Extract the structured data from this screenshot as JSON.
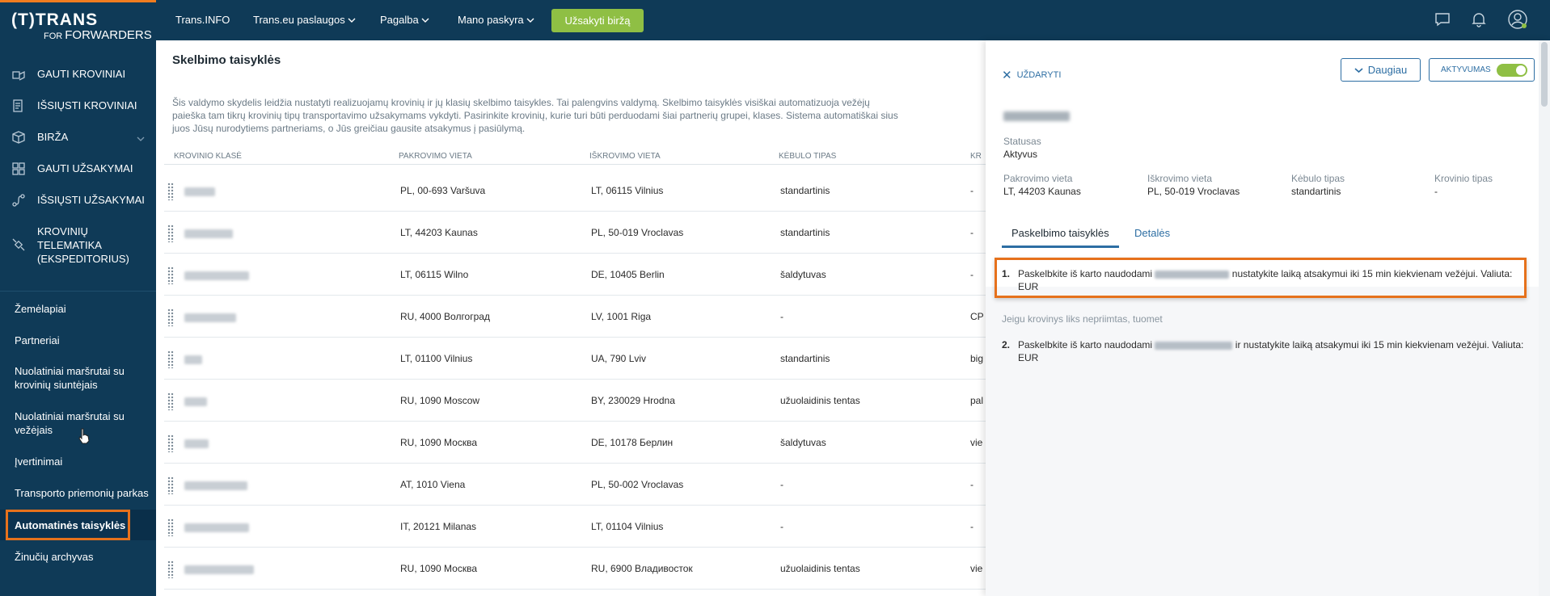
{
  "brand": {
    "logo_top": "(T)TRANS",
    "logo_bottom_small": "FOR",
    "logo_bottom": "FORWARDERS",
    "accent": "#f07c1f",
    "nav_bg": "#0f3a57",
    "cta_color": "#8fbf44"
  },
  "sidebar": {
    "main": [
      {
        "label": "GAUTI KROVINIAI",
        "icon": "boxes-icon"
      },
      {
        "label": "IŠSIŲSTI KROVINIAI",
        "icon": "document-icon"
      },
      {
        "label": "BIRŽA",
        "icon": "cube-icon"
      },
      {
        "label": "GAUTI UŽSAKYMAI",
        "icon": "grid-icon"
      },
      {
        "label": "IŠSIŲSTI UŽSAKYMAI",
        "icon": "route-icon"
      },
      {
        "label": "KROVINIŲ TELEMATIKA (EKSPEDITORIUS)",
        "icon": "satellite-icon"
      }
    ],
    "sub": [
      {
        "label": "Žemėlapiai"
      },
      {
        "label": "Partneriai"
      },
      {
        "label": "Nuolatiniai maršrutai su krovinių siuntėjais"
      },
      {
        "label": "Nuolatiniai maršrutai su vežėjais"
      },
      {
        "label": "Įvertinimai"
      },
      {
        "label": "Transporto priemonių parkas"
      },
      {
        "label": "Automatinės taisyklės"
      },
      {
        "label": "Žinučių archyvas"
      }
    ]
  },
  "topbar": {
    "items": [
      "Trans.INFO",
      "Trans.eu paslaugos",
      "Pagalba",
      "Mano paskyra"
    ],
    "cta": "Užsakyti biržą"
  },
  "content": {
    "title": "Skelbimo taisyklės",
    "description": "Šis valdymo skydelis leidžia nustatyti realizuojamų krovinių ir jų klasių skelbimo taisykles. Tai palengvins valdymą. Skelbimo taisyklės visiškai automatizuoja vežėjų paieška tam tikrų krovinių tipų transportavimo užsakymams vykdyti. Pasirinkite krovinių, kurie turi būti perduodami šiai partnerių grupei, klases. Sistema automatiškai sius juos Jūsų nurodytiems partneriams, o Jūs greičiau gausite atsakymus į pasiūlymą.",
    "columns": [
      "KROVINIO KLASĖ",
      "PAKROVIMO VIETA",
      "IŠKROVIMO VIETA",
      "KĖBULO TIPAS",
      "KR"
    ],
    "rows": [
      {
        "from": "PL, 00-693 Varšuva",
        "to": "LT, 06115 Vilnius",
        "body": "standartinis",
        "extra": "-"
      },
      {
        "from": "LT, 44203 Kaunas",
        "to": "PL, 50-019 Vroclavas",
        "body": "standartinis",
        "extra": "-"
      },
      {
        "from": "LT, 06115 Wilno",
        "to": "DE, 10405 Berlin",
        "body": "šaldytuvas",
        "extra": "-"
      },
      {
        "from": "RU, 4000 Волгоград",
        "to": "LV, 1001 Riga",
        "body": "-",
        "extra": "CP"
      },
      {
        "from": "LT, 01100 Vilnius",
        "to": "UA, 790 Lviv",
        "body": "standartinis",
        "extra": "big"
      },
      {
        "from": "RU, 1090 Moscow",
        "to": "BY, 230029 Hrodna",
        "body": "užuolaidinis tentas",
        "extra": "pal"
      },
      {
        "from": "RU, 1090 Москва",
        "to": "DE, 10178 Берлин",
        "body": "šaldytuvas",
        "extra": "vie"
      },
      {
        "from": "AT, 1010 Viena",
        "to": "PL, 50-002 Vroclavas",
        "body": "-",
        "extra": "-"
      },
      {
        "from": "IT, 20121 Milanas",
        "to": "LT, 01104 Vilnius",
        "body": "-",
        "extra": "-"
      },
      {
        "from": "RU, 1090 Москва",
        "to": "RU, 6900 Владивосток",
        "body": "užuolaidinis tentas",
        "extra": "vie"
      }
    ]
  },
  "panel": {
    "close": "UŽDARYTI",
    "more": "Daugiau",
    "active": "AKTYVUMAS",
    "status_label": "Statusas",
    "status_value": "Aktyvus",
    "fields": [
      {
        "label": "Pakrovimo vieta",
        "value": "LT, 44203 Kaunas"
      },
      {
        "label": "Iškrovimo vieta",
        "value": "PL, 50-019 Vroclavas"
      },
      {
        "label": "Kėbulo tipas",
        "value": "standartinis"
      },
      {
        "label": "Krovinio tipas",
        "value": "-"
      }
    ],
    "tabs": [
      "Paskelbimo taisyklės",
      "Detalės"
    ],
    "rule1_num": "1.",
    "rule1_pre": "Paskelbkite iš karto naudodami",
    "rule1_post": "nustatykite laiką atsakymui iki 15 min kiekvienam vežėjui. Valiuta: EUR",
    "note": "Jeigu krovinys liks nepriimtas, tuomet",
    "rule2_num": "2.",
    "rule2_pre": "Paskelbkite iš karto naudodami",
    "rule2_post": "ir nustatykite laiką atsakymui iki 15 min kiekvienam vežėjui. Valiuta: EUR"
  }
}
